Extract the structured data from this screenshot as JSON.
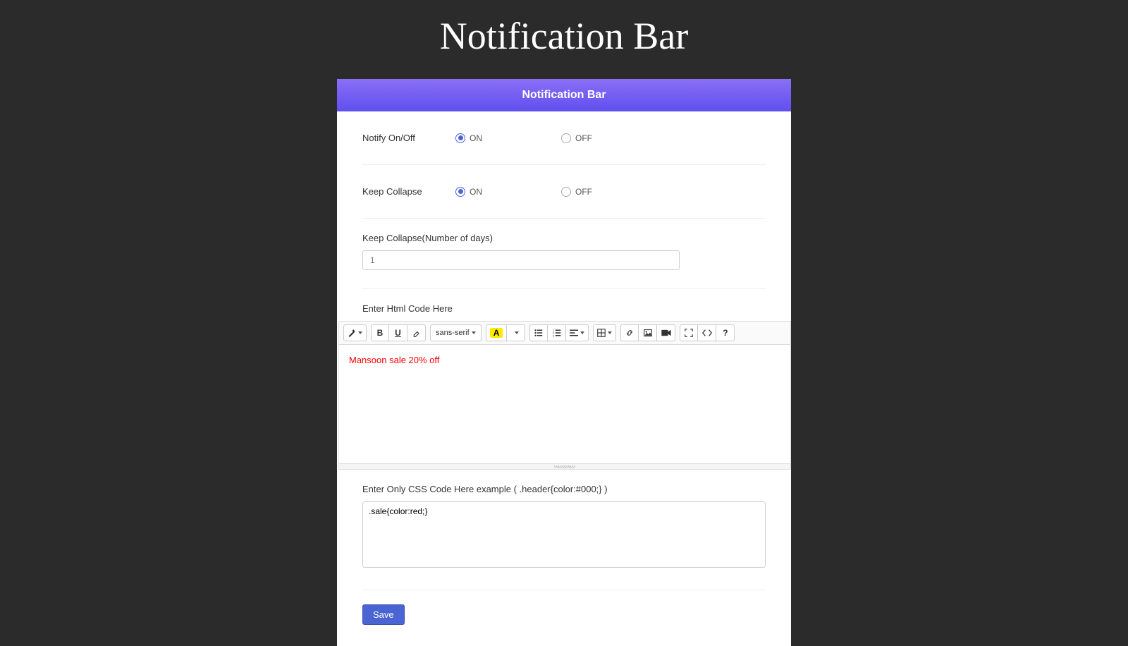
{
  "page_title": "Notification Bar",
  "panel": {
    "header": "Notification Bar",
    "notify_label": "Notify On/Off",
    "collapse_label": "Keep Collapse",
    "on_label": "ON",
    "off_label": "OFF",
    "notify_value": "ON",
    "collapse_value": "ON",
    "days_label": "Keep Collapse(Number of days)",
    "days_placeholder": "1",
    "html_label": "Enter Html Code Here",
    "font_family": "sans-serif",
    "editor_content": "Mansoon sale 20% off",
    "css_label": "Enter Only CSS Code Here example ( .header{color:#000;} )",
    "css_value": ".sale{color:red;}",
    "save_label": "Save"
  }
}
